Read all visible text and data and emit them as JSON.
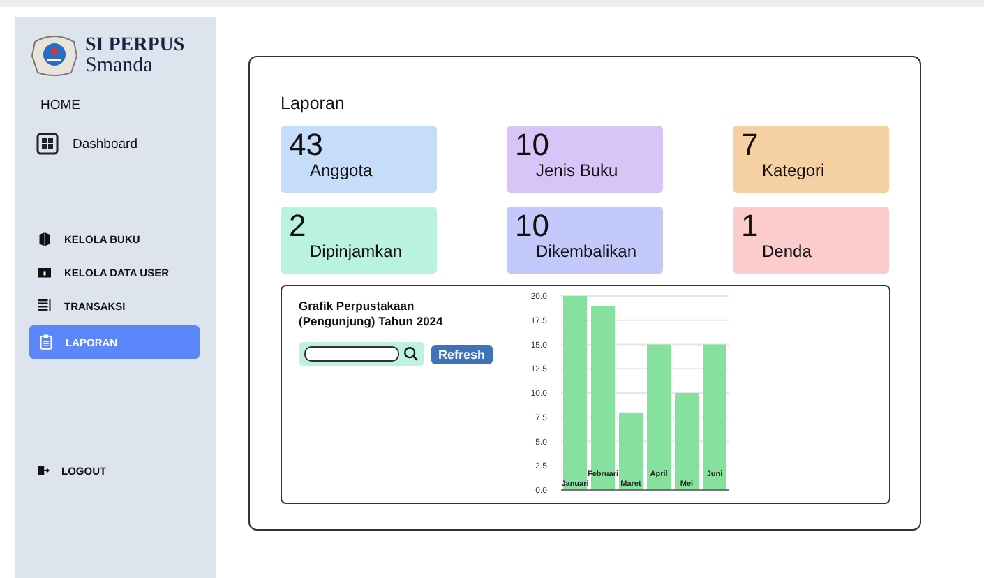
{
  "sidebar": {
    "logo_title": "SI PERPUS",
    "logo_subtitle": "Smanda",
    "sections": [
      {
        "kind": "heading",
        "label": "HOME"
      },
      {
        "kind": "item",
        "label": "Dashboard",
        "selected": false
      },
      {
        "kind": "spacer"
      },
      {
        "kind": "item",
        "label": "KELOLA BUKU",
        "selected": false
      },
      {
        "kind": "item",
        "label": "KELOLA DATA USER",
        "selected": false
      },
      {
        "kind": "item",
        "label": "TRANSAKSI",
        "selected": false
      },
      {
        "kind": "item",
        "label": "LAPORAN",
        "selected": true
      }
    ],
    "logout": "LOGOUT"
  },
  "page_title": "Laporan",
  "stats": [
    {
      "value": "43",
      "label": "Anggota",
      "color": "#c6ddfa"
    },
    {
      "value": "10",
      "label": "Jenis Buku",
      "color": "#d9c4f7"
    },
    {
      "value": "7",
      "label": "Kategori",
      "color": "#f5d0a3"
    },
    {
      "value": "2",
      "label": "Dipinjamkan",
      "color": "#baf2e0"
    },
    {
      "value": "10",
      "label": "Dikembalikan",
      "color": "#c4c9fb"
    },
    {
      "value": "1",
      "label": "Denda",
      "color": "#fccccc"
    }
  ],
  "chart_panel": {
    "title": "Grafik Perpustakaan (Pengunjung) Tahun 2024",
    "refresh": "Refresh",
    "chart_data": {
      "type": "bar",
      "categories": [
        "Januari",
        "Februari",
        "Maret",
        "April",
        "Mei",
        "Juni"
      ],
      "grid": true,
      "series": [
        {
          "color": "#86e09e",
          "values": [
            20,
            19,
            8,
            15,
            10,
            15
          ]
        }
      ],
      "ylim": [
        0,
        20
      ],
      "yticks": [
        {
          "value": 0,
          "label": "0.0"
        },
        {
          "value": 2.5,
          "label": "2.5"
        },
        {
          "value": 5,
          "label": "5.0"
        },
        {
          "value": 7.5,
          "label": "7.5"
        },
        {
          "value": 10,
          "label": "10.0"
        },
        {
          "value": 12.5,
          "label": "12.5"
        },
        {
          "value": 15,
          "label": "15.0"
        },
        {
          "value": 17.5,
          "label": "17.5"
        },
        {
          "value": 20,
          "label": "20.0"
        }
      ]
    }
  }
}
